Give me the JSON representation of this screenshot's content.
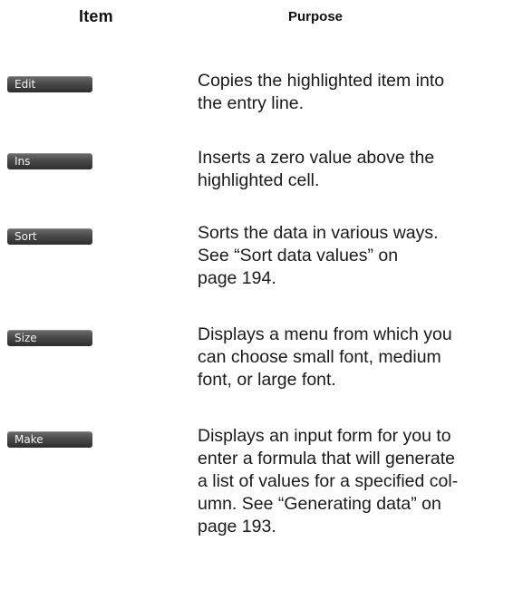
{
  "header": {
    "item": "Item",
    "purpose": "Purpose"
  },
  "rows": [
    {
      "key": "Edit",
      "lines": [
        "Copies the highlighted item into",
        "the entry line."
      ]
    },
    {
      "key": "Ins",
      "lines": [
        "Inserts a zero value above the",
        "highlighted cell."
      ]
    },
    {
      "key": "Sort",
      "lines": [
        "Sorts the data in various ways.",
        "See “Sort data values” on",
        "page 194."
      ]
    },
    {
      "key": "Size",
      "lines": [
        "Displays a menu from which you",
        "can choose small font, medium",
        "font, or large font."
      ]
    },
    {
      "key": "Make",
      "lines": [
        "Displays an input form for you to",
        "enter a formula that will generate",
        "a list of values for a specified col-",
        "umn. See “Generating data” on",
        "page 193."
      ]
    }
  ]
}
